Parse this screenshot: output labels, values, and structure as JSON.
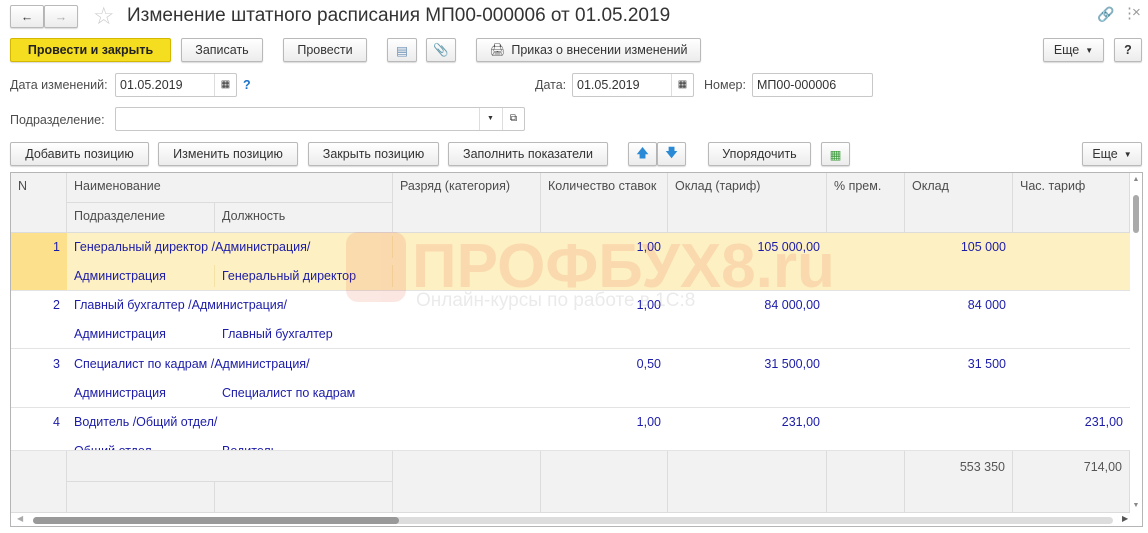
{
  "title": "Изменение штатного расписания МП00-000006 от 01.05.2019",
  "toolbar": {
    "post_close": "Провести и закрыть",
    "save": "Записать",
    "post": "Провести",
    "print": "Приказ о внесении изменений",
    "more": "Еще",
    "help": "?"
  },
  "form": {
    "change_date_label": "Дата изменений:",
    "change_date": "01.05.2019",
    "hint": "?",
    "date_label": "Дата:",
    "date": "01.05.2019",
    "number_label": "Номер:",
    "number": "МП00-000006",
    "dept_label": "Подразделение:",
    "dept": ""
  },
  "table_toolbar": {
    "add": "Добавить позицию",
    "edit": "Изменить позицию",
    "close": "Закрыть позицию",
    "fill": "Заполнить показатели",
    "sort": "Упорядочить",
    "more": "Еще"
  },
  "columns": {
    "n": "N",
    "name": "Наименование",
    "dept": "Подразделение",
    "position": "Должность",
    "grade": "Разряд (категория)",
    "rates": "Количество ставок",
    "salary_tariff": "Оклад (тариф)",
    "bonus": "% прем.",
    "salary": "Оклад",
    "hourly": "Час. тариф"
  },
  "rows": [
    {
      "n": "1",
      "name": "Генеральный директор /Администрация/",
      "dept": "Администрация",
      "position": "Генеральный директор",
      "rates": "1,00",
      "salary_tariff": "105 000,00",
      "salary": "105 000",
      "hourly": ""
    },
    {
      "n": "2",
      "name": "Главный бухгалтер /Администрация/",
      "dept": "Администрация",
      "position": "Главный бухгалтер",
      "rates": "1,00",
      "salary_tariff": "84 000,00",
      "salary": "84 000",
      "hourly": ""
    },
    {
      "n": "3",
      "name": "Специалист по кадрам /Администрация/",
      "dept": "Администрация",
      "position": "Специалист по кадрам",
      "rates": "0,50",
      "salary_tariff": "31 500,00",
      "salary": "31 500",
      "hourly": ""
    },
    {
      "n": "4",
      "name": "Водитель /Общий отдел/",
      "dept": "Общий отдел",
      "position": "Водитель",
      "rates": "1,00",
      "salary_tariff": "231,00",
      "salary": "",
      "hourly": "231,00"
    }
  ],
  "totals": {
    "salary": "553 350",
    "hourly": "714,00"
  },
  "watermark": {
    "brand": "ПРОФБУХ8.ru",
    "tagline": "Онлайн-курсы по работе в 1С:8"
  }
}
